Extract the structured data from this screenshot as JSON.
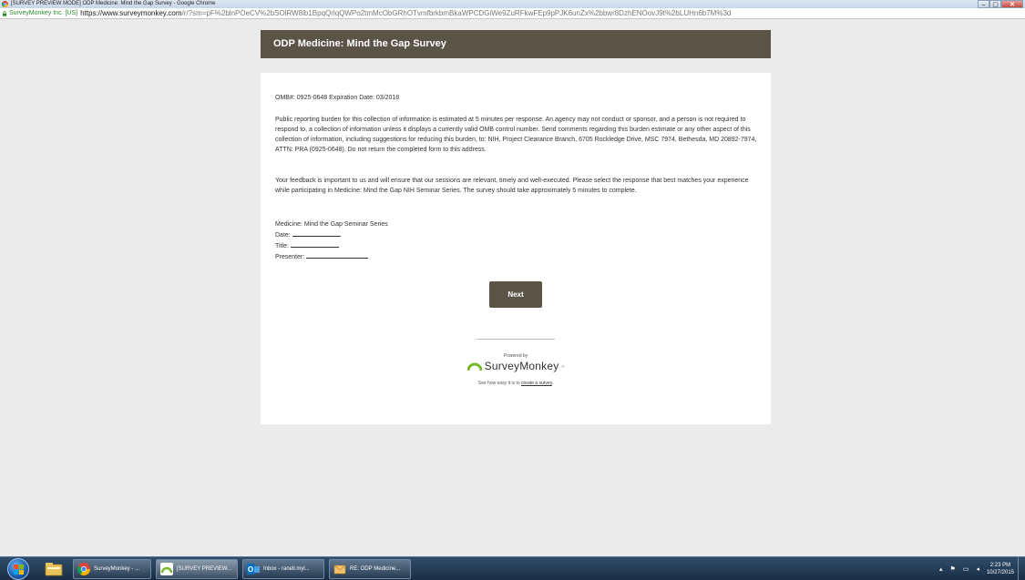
{
  "window": {
    "title": "[SURVEY PREVIEW MODE] ODP Medicine: Mind the Gap Survey - Google Chrome",
    "minimize": "–",
    "maximize": "▢",
    "close": "✕"
  },
  "address_bar": {
    "ev_name": "SurveyMonkey Inc. [US]",
    "url_host": "https://www.surveymonkey.com",
    "url_rest": "/r/?sm=pF%2blnPOeCV%2bSOlRW8lb1BpqQrlqQWPo2tmMcObGRhOTvmfbrkbmBkaWPCDGiWe9ZuRFkwFEp9pPJK6unZx%2bbwr8DzhENOovJ9t%2bLUHn6b7M%3d"
  },
  "survey": {
    "title": "ODP Medicine: Mind the Gap Survey",
    "omb": "OMB#: 0925-0648 Expiration Date: 03/2018",
    "burden": "Public reporting burden for this collection of information is estimated at 5 minutes per response. An agency may not conduct or sponsor, and a person is not required to respond to, a collection of information unless it displays a currently valid OMB control number. Send comments regarding this burden estimate or any other aspect of this collection of information, including suggestions for reducing this burden, to: NIH, Project Clearance Branch, 6705 Rockledge Drive, MSC 7974, Bethesda, MD 20892-7974, ATTN: PRA (0925-0648). Do not return the completed form to this address.",
    "feedback": "Your feedback is important to us and will ensure that our sessions are relevant, timely and well-executed. Please select the response that best matches your experience while participating in Medicine: Mind the Gap NIH Seminar Series. The survey should take approximately 5 minutes to complete.",
    "series_title": "Medicine: Mind the Gap Seminar Series",
    "date_label": "Date:",
    "title_label": "Title:",
    "presenter_label": "Presenter:",
    "next_label": "Next"
  },
  "footer": {
    "powered_by": "Powered by",
    "brand": "SurveyMonkey",
    "tm": "®",
    "see_how_prefix": "See how easy it is to ",
    "create_link": "create a survey",
    "see_how_suffix": "."
  },
  "taskbar": {
    "items": [
      {
        "label": "SurveyMonkey - ..."
      },
      {
        "label": "[SURVEY PREVIEW..."
      },
      {
        "label": "Inbox - ranell.myl..."
      },
      {
        "label": "RE: ODP Medicine..."
      }
    ],
    "time": "2:23 PM",
    "date": "10/27/2015"
  },
  "colors": {
    "header_bg": "#595445",
    "button_bg": "#595445",
    "page_bg": "#ebebeb",
    "brand_green": "#76b82a"
  }
}
